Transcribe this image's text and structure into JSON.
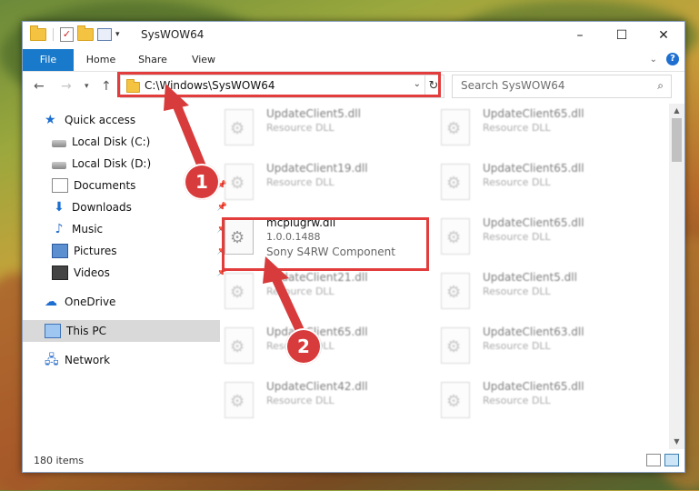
{
  "window": {
    "title": "SysWOW64"
  },
  "ribbon": {
    "tabs": [
      "File",
      "Home",
      "Share",
      "View"
    ]
  },
  "address": {
    "path": "C:\\Windows\\SysWOW64"
  },
  "search": {
    "placeholder": "Search SysWOW64"
  },
  "sidebar": {
    "items": [
      {
        "label": "Quick access",
        "icon": "star-icon"
      },
      {
        "label": "Local Disk (C:)",
        "icon": "disk-icon"
      },
      {
        "label": "Local Disk (D:)",
        "icon": "disk-icon"
      },
      {
        "label": "Documents",
        "icon": "documents-icon",
        "pinned": true
      },
      {
        "label": "Downloads",
        "icon": "downloads-icon",
        "pinned": true
      },
      {
        "label": "Music",
        "icon": "music-icon",
        "pinned": true
      },
      {
        "label": "Pictures",
        "icon": "pictures-icon",
        "pinned": true
      },
      {
        "label": "Videos",
        "icon": "videos-icon",
        "pinned": true
      },
      {
        "label": "OneDrive",
        "icon": "cloud-icon"
      },
      {
        "label": "This PC",
        "icon": "pc-icon",
        "selected": true
      },
      {
        "label": "Network",
        "icon": "network-icon"
      }
    ]
  },
  "files": {
    "left": [
      {
        "name": "UpdateClient5.dll",
        "desc": "Resource DLL"
      },
      {
        "name": "UpdateClient19.dll",
        "desc": "Resource DLL"
      },
      {
        "name": "mcplugrw.dll",
        "version": "1.0.0.1488",
        "desc": "Sony S4RW Component"
      },
      {
        "name": "UpdateClient21.dll",
        "desc": "Resource DLL"
      },
      {
        "name": "UpdateClient65.dll",
        "desc": "Resource DLL"
      },
      {
        "name": "UpdateClient42.dll",
        "desc": "Resource DLL"
      }
    ],
    "right": [
      {
        "name": "UpdateClient65.dll",
        "desc": "Resource DLL"
      },
      {
        "name": "UpdateClient65.dll",
        "desc": "Resource DLL"
      },
      {
        "name": "UpdateClient65.dll",
        "desc": "Resource DLL"
      },
      {
        "name": "UpdateClient5.dll",
        "desc": "Resource DLL"
      },
      {
        "name": "UpdateClient63.dll",
        "desc": "Resource DLL"
      },
      {
        "name": "UpdateClient65.dll",
        "desc": "Resource DLL"
      }
    ]
  },
  "status": {
    "items": "180 items"
  },
  "annotations": {
    "step1": "1",
    "step2": "2",
    "color": "#d83b3b"
  }
}
